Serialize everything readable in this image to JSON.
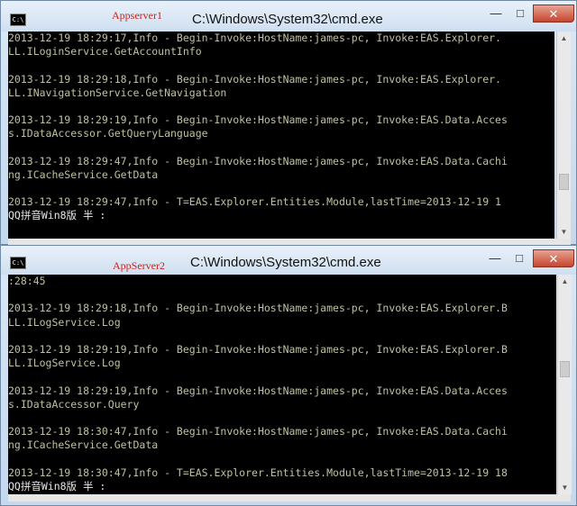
{
  "windows": [
    {
      "tag": "Appserver1",
      "title": "C:\\Windows\\System32\\cmd.exe",
      "controls": {
        "minimize": "—",
        "maximize": "□",
        "close": "✕"
      },
      "icon_text": "C:\\",
      "lines": [
        "2013-12-19 18:29:17,Info - Begin-Invoke:HostName:james-pc, Invoke:EAS.Explorer.",
        "LL.ILoginService.GetAccountInfo",
        "",
        "2013-12-19 18:29:18,Info - Begin-Invoke:HostName:james-pc, Invoke:EAS.Explorer.",
        "LL.INavigationService.GetNavigation",
        "",
        "2013-12-19 18:29:19,Info - Begin-Invoke:HostName:james-pc, Invoke:EAS.Data.Acces",
        "s.IDataAccessor.GetQueryLanguage",
        "",
        "2013-12-19 18:29:47,Info - Begin-Invoke:HostName:james-pc, Invoke:EAS.Data.Cachi",
        "ng.ICacheService.GetData",
        "",
        "2013-12-19 18:29:47,Info - T=EAS.Explorer.Entities.Module,lastTime=2013-12-19 1"
      ],
      "ime": "QQ拼音Win8版 半 :"
    },
    {
      "tag": "AppServer2",
      "title": "C:\\Windows\\System32\\cmd.exe",
      "controls": {
        "minimize": "—",
        "maximize": "□",
        "close": "✕"
      },
      "icon_text": "C:\\",
      "lines": [
        ":28:45",
        "",
        "2013-12-19 18:29:18,Info - Begin-Invoke:HostName:james-pc, Invoke:EAS.Explorer.B",
        "LL.ILogService.Log",
        "",
        "2013-12-19 18:29:19,Info - Begin-Invoke:HostName:james-pc, Invoke:EAS.Explorer.B",
        "LL.ILogService.Log",
        "",
        "2013-12-19 18:29:19,Info - Begin-Invoke:HostName:james-pc, Invoke:EAS.Data.Acces",
        "s.IDataAccessor.Query",
        "",
        "2013-12-19 18:30:47,Info - Begin-Invoke:HostName:james-pc, Invoke:EAS.Data.Cachi",
        "ng.ICacheService.GetData",
        "",
        "2013-12-19 18:30:47,Info - T=EAS.Explorer.Entities.Module,lastTime=2013-12-19 18"
      ],
      "ime": "QQ拼音Win8版 半 :"
    }
  ]
}
